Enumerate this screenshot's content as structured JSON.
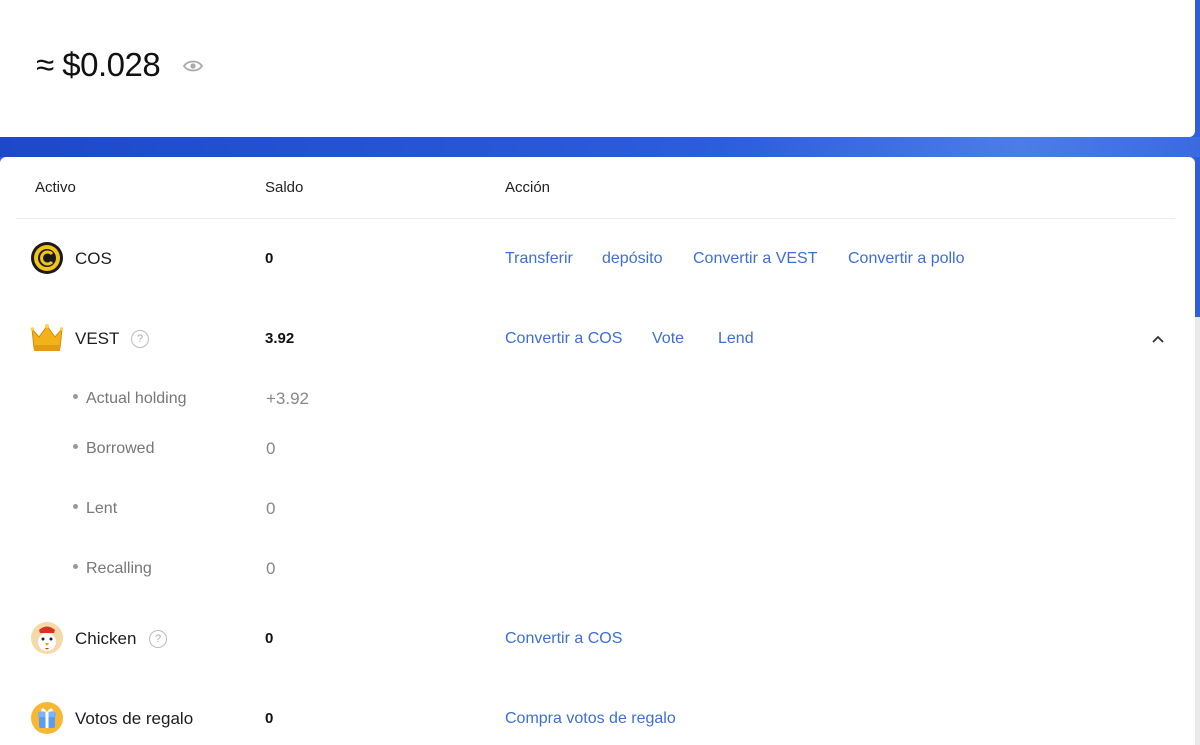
{
  "balance": {
    "value": "≈ $0.028"
  },
  "table": {
    "headers": {
      "asset": "Activo",
      "balance": "Saldo",
      "action": "Acción"
    },
    "rows": [
      {
        "name": "COS",
        "balance": "0",
        "actions": [
          "Transferir",
          "depósito",
          "Convertir a VEST",
          "Convertir a pollo"
        ]
      },
      {
        "name": "VEST",
        "balance": "3.92",
        "actions": [
          "Convertir a COS",
          "Vote",
          "Lend"
        ],
        "details": [
          {
            "label": "Actual holding",
            "value": "+3.92"
          },
          {
            "label": "Borrowed",
            "value": "0"
          },
          {
            "label": "Lent",
            "value": "0"
          },
          {
            "label": "Recalling",
            "value": "0"
          }
        ]
      },
      {
        "name": "Chicken",
        "balance": "0",
        "actions": [
          "Convertir a COS"
        ]
      },
      {
        "name": "Votos de regalo",
        "balance": "0",
        "actions": [
          "Compra votos de regalo"
        ]
      }
    ]
  },
  "help_glyph": "?",
  "colors": {
    "accent": "#3d6fd6",
    "band": "#2d5fd8"
  }
}
